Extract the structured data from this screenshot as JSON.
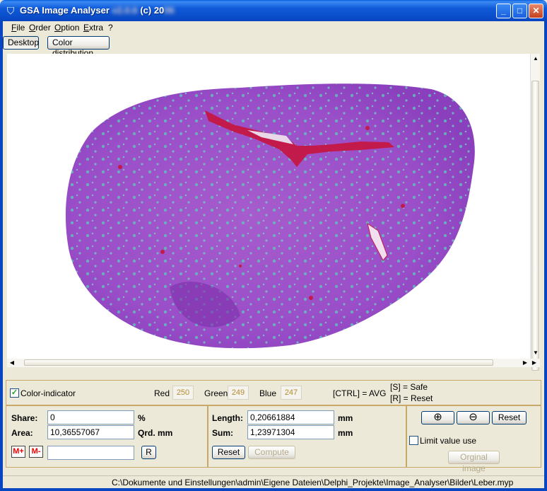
{
  "window": {
    "title": "GSA Image Analyser ",
    "title_obscured": "v2.0.6",
    "title_copyright": " (c) 20",
    "title_obscured2": "06",
    "min_glyph": "_",
    "max_glyph": "□",
    "close_glyph": "✕"
  },
  "menu": [
    {
      "accel": "F",
      "rest": "ile"
    },
    {
      "accel": "O",
      "rest": "rder"
    },
    {
      "accel": "O",
      "rest": "ption"
    },
    {
      "accel": "E",
      "rest": "xtra"
    },
    {
      "accel": "",
      "rest": "?"
    }
  ],
  "tabs": {
    "desktop": "Desktop",
    "color_distribution": "Color distribution"
  },
  "colors": {
    "accent": "#0a4dc9",
    "tissue_purple": "#9c4fc4",
    "tissue_cyan": "#63c8c0",
    "vessel_red": "#c21a4a"
  },
  "color_panel": {
    "indicator_label": "Color-indicator",
    "indicator_checked": "✓",
    "red_label": "Red",
    "red_value": "250",
    "green_label": "Green",
    "green_value": "249",
    "blue_label": "Blue",
    "blue_value": "247",
    "ctrl_hint": "[CTRL] = AVG",
    "s_hint": "[S] = Safe",
    "r_hint": "[R] = Reset"
  },
  "area_panel": {
    "share_label": "Share:",
    "share_value": "0",
    "share_unit": "%",
    "area_label": "Area:",
    "area_value": "10,36557067",
    "area_unit": "Qrd. mm",
    "mplus": "M+",
    "mminus": "M-",
    "memory_value": "",
    "r_button": "R"
  },
  "length_panel": {
    "length_label": "Length:",
    "length_value": "0,20661884",
    "length_unit": "mm",
    "sum_label": "Sum:",
    "sum_value": "1,23971304",
    "sum_unit": "mm",
    "reset_label": "Reset",
    "compute_label": "Compute"
  },
  "zoom_panel": {
    "zoom_in_icon": "⊕",
    "zoom_out_icon": "⊖",
    "reset_label": "Reset",
    "limit_label": "Limit value use",
    "original_label": "Orginal image"
  },
  "status": {
    "path": "C:\\Dokumente und Einstellungen\\admin\\Eigene Dateien\\Delphi_Projekte\\Image_Analyser\\Bilder\\Leber.myp"
  }
}
